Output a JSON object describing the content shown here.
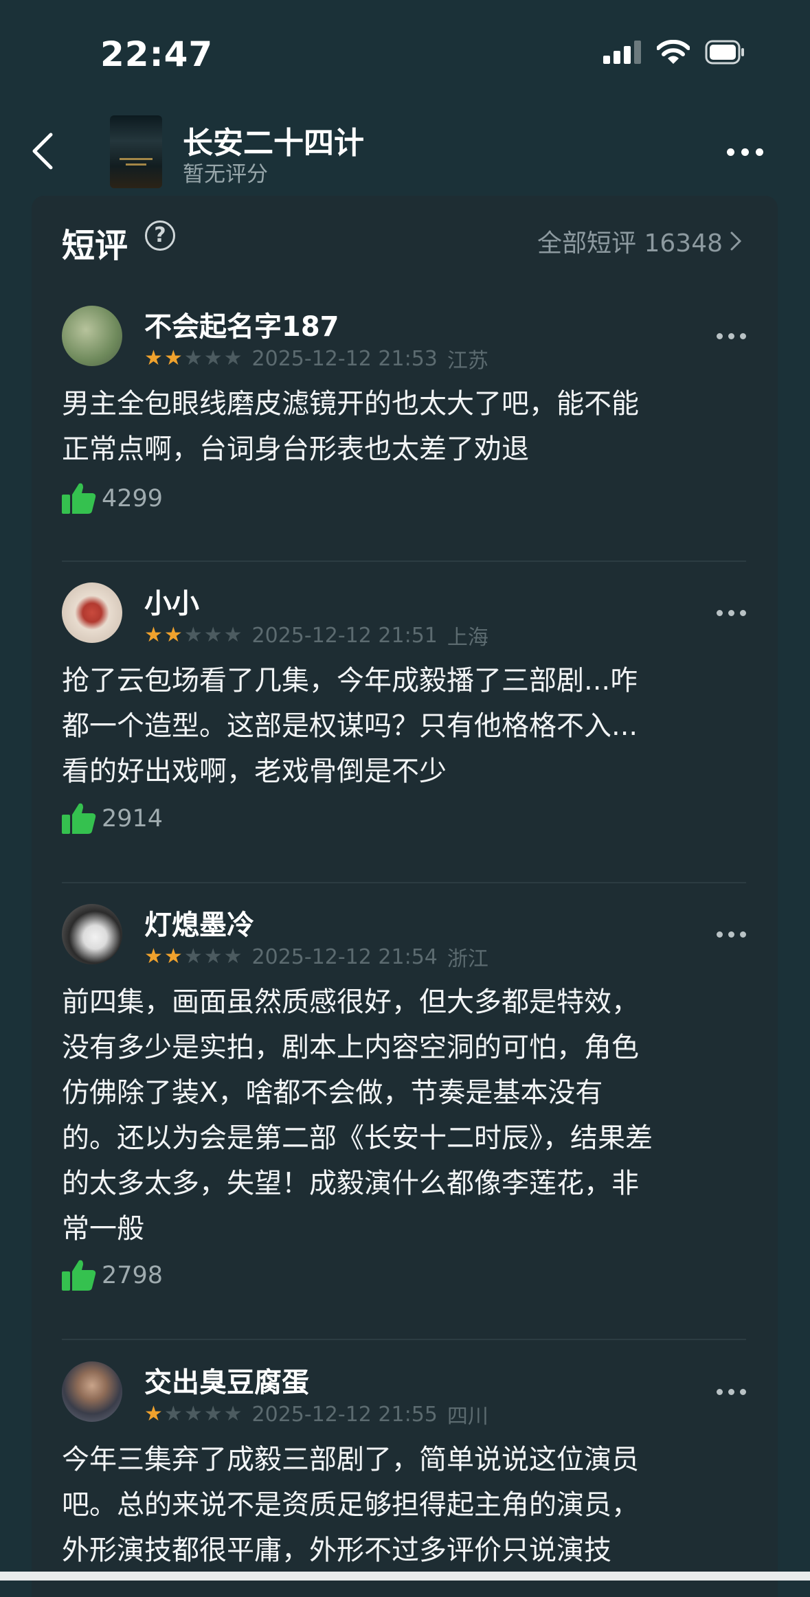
{
  "status": {
    "time": "22:47"
  },
  "nav": {
    "title": "长安二十四计",
    "subtitle": "暂无评分"
  },
  "section": {
    "title": "短评",
    "help": "?",
    "all_label": "全部短评 16348"
  },
  "colors": {
    "star_on": "#f0a22d",
    "like_icon": "#35c14f",
    "background": "#1b3138"
  },
  "reviews": [
    {
      "user": "不会起名字187",
      "rating": 2,
      "date": "2025-12-12 21:53",
      "region": "江苏",
      "lines": [
        "男主全包眼线磨皮滤镜开的也太大了吧，能不能",
        "正常点啊，台词身台形表也太差了劝退"
      ],
      "likes": "4299"
    },
    {
      "user": "小小",
      "rating": 2,
      "date": "2025-12-12 21:51",
      "region": "上海",
      "lines": [
        "抢了云包场看了几集，今年成毅播了三部剧...咋",
        "都一个造型。这部是权谋吗？只有他格格不入...",
        "看的好出戏啊，老戏骨倒是不少"
      ],
      "likes": "2914"
    },
    {
      "user": "灯熄墨冷",
      "rating": 2,
      "date": "2025-12-12 21:54",
      "region": "浙江",
      "lines": [
        "前四集，画面虽然质感很好，但大多都是特效，",
        "没有多少是实拍，剧本上内容空洞的可怕，角色",
        "仿佛除了装X，啥都不会做，节奏是基本没有",
        "的。还以为会是第二部《长安十二时辰》，结果差",
        "的太多太多，失望！成毅演什么都像李莲花，非",
        "常一般"
      ],
      "likes": "2798"
    },
    {
      "user": "交出臭豆腐蛋",
      "rating": 1,
      "date": "2025-12-12 21:55",
      "region": "四川",
      "lines": [
        "今年三集弃了成毅三部剧了，简单说说这位演员",
        "吧。总的来说不是资质足够担得起主角的演员，",
        "外形演技都很平庸，外形不过多评价只说演技"
      ],
      "likes": ""
    }
  ]
}
